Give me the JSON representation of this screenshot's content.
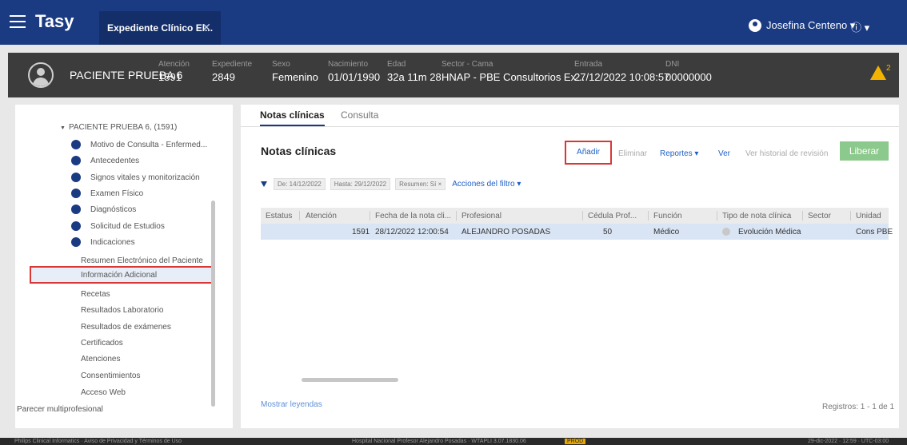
{
  "app": {
    "brand": "Tasy",
    "tab_label": "Expediente Clínico El...",
    "tab_close": "✕",
    "user": "Josefina Centeno ▾",
    "info": "ⓘ ▾"
  },
  "patient": {
    "name": "PACIENTE PRUEBA 6",
    "fields": [
      {
        "label": "Atención",
        "value": "1591"
      },
      {
        "label": "Expediente",
        "value": "2849"
      },
      {
        "label": "Sexo",
        "value": "Femenino"
      },
      {
        "label": "Nacimiento",
        "value": "01/01/1990"
      },
      {
        "label": "Edad",
        "value": "32a 11m 28"
      },
      {
        "label": "Sector - Cama",
        "value": "HNAP - PBE Consultorios Ex..."
      },
      {
        "label": "Entrada",
        "value": "27/12/2022 10:08:57"
      },
      {
        "label": "DNI",
        "value": "00000000"
      }
    ],
    "alert_count": "2"
  },
  "tree": {
    "root": "PACIENTE PRUEBA 6, (1591)",
    "items": [
      "Motivo de Consulta - Enfermed...",
      "Antecedentes",
      "Signos vitales y monitorización",
      "Examen Físico",
      "Diagnósticos",
      "Solicitud de Estudios",
      "Indicaciones"
    ],
    "subitems_top": [
      "Resumen Electrónico del Paciente"
    ],
    "selected": "Información Adicional",
    "subitems_bottom": [
      "Recetas",
      "Resultados Laboratorio",
      "Resultados de exámenes",
      "Certificados",
      "Atenciones",
      "Consentimientos",
      "Acceso Web"
    ],
    "footer": "Parecer multiprofesional"
  },
  "main": {
    "tabs": [
      "Notas clínicas",
      "Consulta"
    ],
    "title": "Notas clínicas",
    "toolbar": {
      "add": "Añadir",
      "delete": "Eliminar",
      "reports": "Reportes ▾",
      "view": "Ver",
      "history": "Ver historial de revisión",
      "release": "Liberar"
    },
    "filters": {
      "from": "De: 14/12/2022",
      "to": "Hasta: 29/12/2022",
      "summary": "Resumen: Sí  ×",
      "actions": "Acciones del filtro ▾"
    },
    "table": {
      "headers": [
        "Estatus",
        "Atención",
        "Fecha de la nota cli...",
        "Profesional",
        "Cédula Prof...",
        "Función",
        "Tipo de nota clínica",
        "Sector",
        "Unidad"
      ],
      "row": {
        "attention": "1591",
        "date": "28/12/2022 12:00:54",
        "professional": "ALEJANDRO POSADAS",
        "license": "50",
        "role": "Médico",
        "note_type": "Evolución Médica",
        "unit": "Cons PBE"
      }
    },
    "legend_link": "Mostrar leyendas",
    "records": "Registros: 1 - 1 de 1"
  },
  "statusbar": {
    "left": "Philips Clinical Informatics · Aviso de Privacidad y Términos de Uso",
    "center": "Hospital Nacional Profesor Alejandro Posadas · WTAPLI 3.07.1830.06",
    "badge": "PROD",
    "right": "29-dic-2022 · 12:59 · UTC-03:00"
  }
}
